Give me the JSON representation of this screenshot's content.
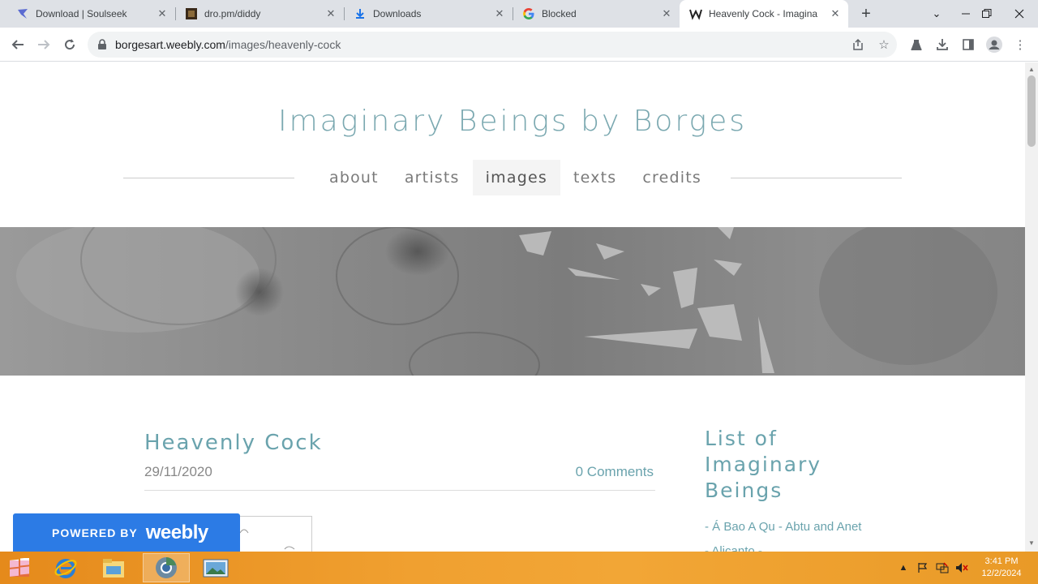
{
  "browser": {
    "tabs": [
      {
        "title": "Download | Soulseek",
        "icon": "soulseek-icon"
      },
      {
        "title": "dro.pm/diddy",
        "icon": "dropm-icon"
      },
      {
        "title": "Downloads",
        "icon": "download-icon"
      },
      {
        "title": "Blocked",
        "icon": "google-icon"
      },
      {
        "title": "Heavenly  Cock - Imagina",
        "icon": "weebly-icon",
        "active": true
      }
    ],
    "url_host": "borgesart.weebly.com",
    "url_path": "/images/heavenly-cock"
  },
  "site": {
    "title": "Imaginary Beings by Borges",
    "nav": [
      "about",
      "artists",
      "images",
      "texts",
      "credits"
    ],
    "active_nav": "images"
  },
  "post": {
    "title": "Heavenly  Cock",
    "date": "29/11/2020",
    "comments": "0 Comments"
  },
  "sidebar": {
    "title": "List of Imaginary Beings",
    "text": " - Á Bao A Qu - Abtu and Anet - Alicanto -"
  },
  "weebly_badge": {
    "powered": "POWERED BY",
    "brand": "weebly"
  },
  "taskbar": {
    "time": "3:41 PM",
    "date": "12/2/2024"
  },
  "colors": {
    "accent": "#6aa3ad",
    "weebly_blue": "#2c7be5",
    "taskbar": "#f0a030"
  }
}
